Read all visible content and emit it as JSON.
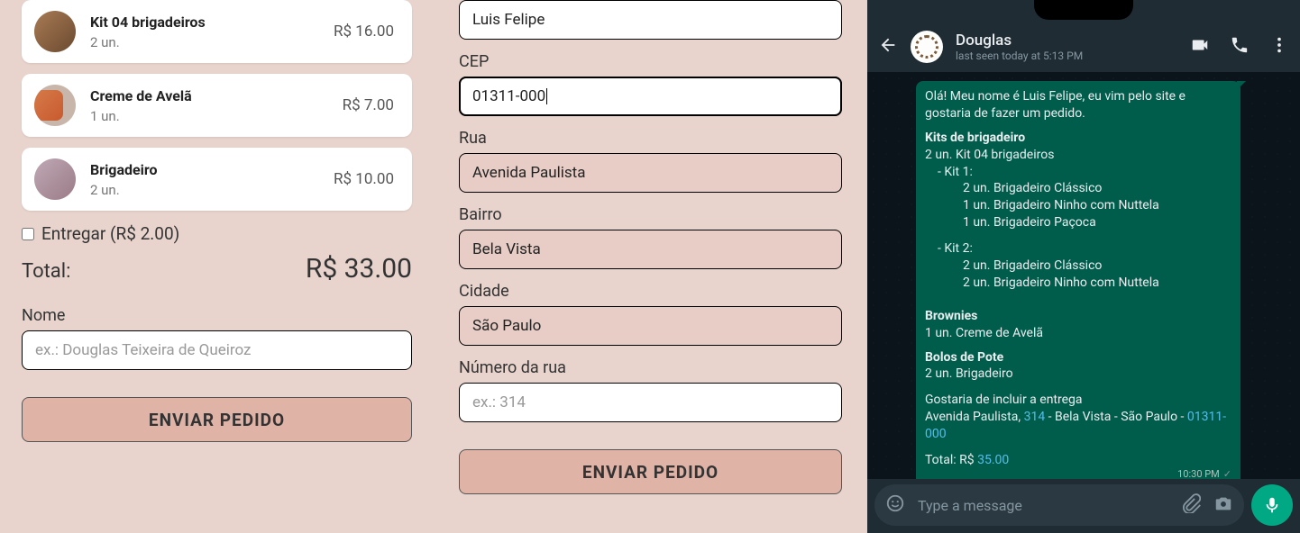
{
  "cart": {
    "items": [
      {
        "title": "Kit 04 brigadeiros",
        "qty": "2 un.",
        "price": "R$ 16.00"
      },
      {
        "title": "Creme de Avelã",
        "qty": "1 un.",
        "price": "R$ 7.00"
      },
      {
        "title": "Brigadeiro",
        "qty": "2 un.",
        "price": "R$ 10.00"
      }
    ],
    "deliver_label": "Entregar (R$ 2.00)",
    "total_label": "Total:",
    "total_value": "R$ 33.00",
    "name_label": "Nome",
    "name_placeholder": "ex.: Douglas Teixeira de Queiroz",
    "send_label": "ENVIAR PEDIDO"
  },
  "form": {
    "name_value": "Luis Felipe",
    "cep_label": "CEP",
    "cep_value": "01311-000",
    "rua_label": "Rua",
    "rua_value": "Avenida Paulista",
    "bairro_label": "Bairro",
    "bairro_value": "Bela Vista",
    "cidade_label": "Cidade",
    "cidade_value": "São Paulo",
    "numero_label": "Número da rua",
    "numero_placeholder": "ex.: 314",
    "send_label": "ENVIAR PEDIDO"
  },
  "whatsapp": {
    "contact_name": "Douglas",
    "status": "last seen today at 5:13 PM",
    "input_placeholder": "Type a message",
    "msg": {
      "intro": "Olá! Meu nome é Luis Felipe, eu vim pelo site e gostaria de fazer um pedido.",
      "sec1_title": "Kits de brigadeiro",
      "sec1_line1": "2 un. Kit 04 brigadeiros",
      "sec1_kit1": "- Kit 1:",
      "sec1_kit1_a": "2 un. Brigadeiro Clássico",
      "sec1_kit1_b": "1 un. Brigadeiro Ninho com Nuttela",
      "sec1_kit1_c": "1 un. Brigadeiro Paçoca",
      "sec1_kit2": "- Kit 2:",
      "sec1_kit2_a": "2 un. Brigadeiro Clássico",
      "sec1_kit2_b": "2 un. Brigadeiro Ninho com Nuttela",
      "sec2_title": "Brownies",
      "sec2_a": "1 un. Creme de Avelã",
      "sec3_title": "Bolos de Pote",
      "sec3_a": "2 un. Brigadeiro",
      "delivery_intro": "Gostaria de incluir a entrega",
      "addr_street": "Avenida Paulista, ",
      "addr_num": "314",
      "addr_mid": " - Bela Vista - São Paulo - ",
      "addr_cep": "01311-000",
      "total_prefix": "Total: R$ ",
      "total_num": "35.00",
      "time": "10:30 PM"
    }
  }
}
